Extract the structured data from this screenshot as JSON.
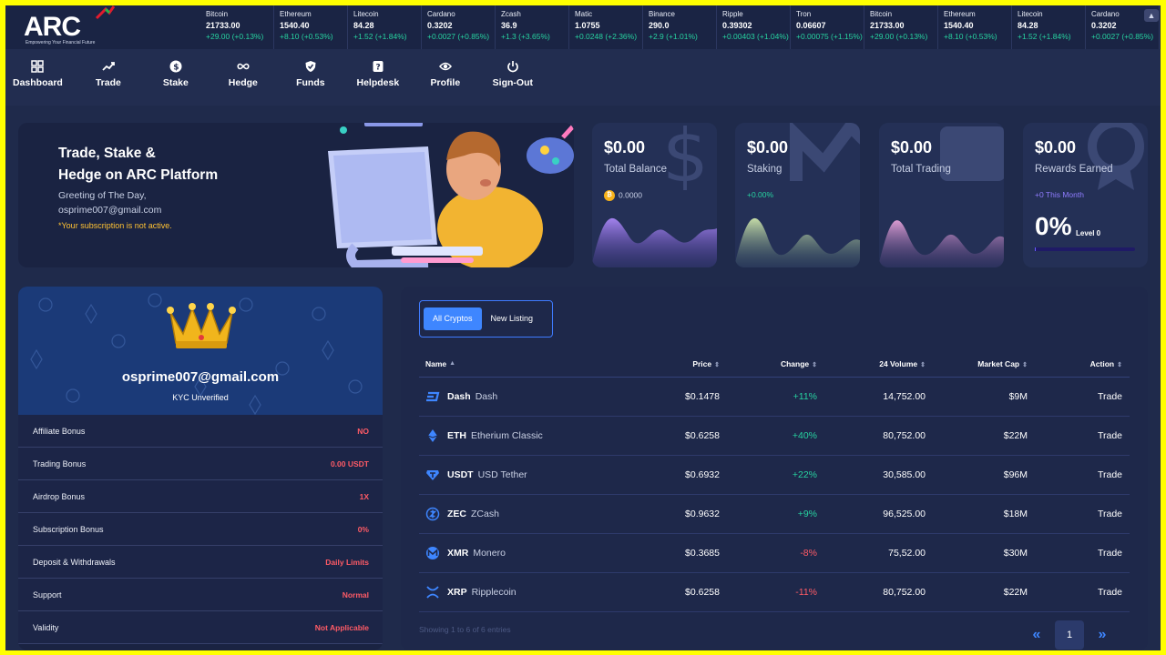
{
  "brand": {
    "name": "ARC",
    "tagline": "Empowering Your Financial Future"
  },
  "ticker": [
    {
      "name": "Bitcoin",
      "price": "21733.00",
      "change": "+29.00 (+0.13%)"
    },
    {
      "name": "Ethereum",
      "price": "1540.40",
      "change": "+8.10 (+0.53%)"
    },
    {
      "name": "Litecoin",
      "price": "84.28",
      "change": "+1.52 (+1.84%)"
    },
    {
      "name": "Cardano",
      "price": "0.3202",
      "change": "+0.0027 (+0.85%)"
    },
    {
      "name": "Zcash",
      "price": "36.9",
      "change": "+1.3 (+3.65%)"
    },
    {
      "name": "Matic",
      "price": "1.0755",
      "change": "+0.0248 (+2.36%)"
    },
    {
      "name": "Binance",
      "price": "290.0",
      "change": "+2.9 (+1.01%)"
    },
    {
      "name": "Ripple",
      "price": "0.39302",
      "change": "+0.00403 (+1.04%)"
    },
    {
      "name": "Tron",
      "price": "0.06607",
      "change": "+0.00075 (+1.15%)"
    },
    {
      "name": "Bitcoin",
      "price": "21733.00",
      "change": "+29.00 (+0.13%)"
    },
    {
      "name": "Ethereum",
      "price": "1540.40",
      "change": "+8.10 (+0.53%)"
    },
    {
      "name": "Litecoin",
      "price": "84.28",
      "change": "+1.52 (+1.84%)"
    },
    {
      "name": "Cardano",
      "price": "0.3202",
      "change": "+0.0027 (+0.85%)"
    }
  ],
  "nav": [
    {
      "label": "Dashboard",
      "icon": "grid-icon"
    },
    {
      "label": "Trade",
      "icon": "trend-up-icon"
    },
    {
      "label": "Stake",
      "icon": "dollar-coin-icon"
    },
    {
      "label": "Hedge",
      "icon": "infinity-icon"
    },
    {
      "label": "Funds",
      "icon": "shield-check-icon"
    },
    {
      "label": "Helpdesk",
      "icon": "question-icon"
    },
    {
      "label": "Profile",
      "icon": "eye-icon"
    },
    {
      "label": "Sign-Out",
      "icon": "power-icon"
    }
  ],
  "welcome": {
    "title_line1": "Trade, Stake &",
    "title_line2": "Hedge on ARC Platform",
    "greeting": "Greeting of The Day,",
    "email": "osprime007@gmail.com",
    "warning": "*Your subscription is not active."
  },
  "stats": {
    "balance": {
      "value": "$0.00",
      "label": "Total Balance",
      "coin_value": "0.0000",
      "coin_symbol": "₿"
    },
    "staking": {
      "value": "$0.00",
      "label": "Staking",
      "sub": "+0.00%"
    },
    "trading": {
      "value": "$0.00",
      "label": "Total Trading"
    },
    "rewards": {
      "value": "$0.00",
      "label": "Rewards Earned",
      "sub": "+0 This Month",
      "percent": "0%",
      "level": "Level 0",
      "progress": 0
    }
  },
  "profile": {
    "email": "osprime007@gmail.com",
    "kyc": "KYC Unverified",
    "rows": [
      {
        "label": "Affiliate Bonus",
        "value": "NO"
      },
      {
        "label": "Trading Bonus",
        "value": "0.00 USDT"
      },
      {
        "label": "Airdrop Bonus",
        "value": "1X"
      },
      {
        "label": "Subscription Bonus",
        "value": "0%"
      },
      {
        "label": "Deposit & Withdrawals",
        "value": "Daily Limits"
      },
      {
        "label": "Support",
        "value": "Normal"
      },
      {
        "label": "Validity",
        "value": "Not Applicable"
      }
    ]
  },
  "market": {
    "tabs": [
      "All Cryptos",
      "New Listing"
    ],
    "headers": {
      "name": "Name",
      "price": "Price",
      "change": "Change",
      "volume": "24 Volume",
      "cap": "Market Cap",
      "action": "Action"
    },
    "rows": [
      {
        "symbol": "Dash",
        "name": "Dash",
        "price": "$0.1478",
        "change": "+11%",
        "volume": "14,752.00",
        "cap": "$9M",
        "action": "Trade",
        "icon": "dash-icon",
        "color": "#3e86ff"
      },
      {
        "symbol": "ETH",
        "name": "Etherium Classic",
        "price": "$0.6258",
        "change": "+40%",
        "volume": "80,752.00",
        "cap": "$22M",
        "action": "Trade",
        "icon": "ethereum-icon",
        "color": "#3e86ff"
      },
      {
        "symbol": "USDT",
        "name": "USD Tether",
        "price": "$0.6932",
        "change": "+22%",
        "volume": "30,585.00",
        "cap": "$96M",
        "action": "Trade",
        "icon": "tether-icon",
        "color": "#3e86ff"
      },
      {
        "symbol": "ZEC",
        "name": "ZCash",
        "price": "$0.9632",
        "change": "+9%",
        "volume": "96,525.00",
        "cap": "$18M",
        "action": "Trade",
        "icon": "zcash-icon",
        "color": "#3e86ff"
      },
      {
        "symbol": "XMR",
        "name": "Monero",
        "price": "$0.3685",
        "change": "-8%",
        "volume": "75,52.00",
        "cap": "$30M",
        "action": "Trade",
        "icon": "monero-icon",
        "color": "#3e86ff"
      },
      {
        "symbol": "XRP",
        "name": "Ripplecoin",
        "price": "$0.6258",
        "change": "-11%",
        "volume": "80,752.00",
        "cap": "$22M",
        "action": "Trade",
        "icon": "ripple-icon",
        "color": "#3e86ff"
      }
    ],
    "showing": "Showing 1 to 6 of 6 entries",
    "page": "1"
  },
  "colors": {
    "positive": "#27d3a0",
    "negative": "#ff5b66",
    "accent": "#3e86ff",
    "warning": "#ffc233"
  }
}
